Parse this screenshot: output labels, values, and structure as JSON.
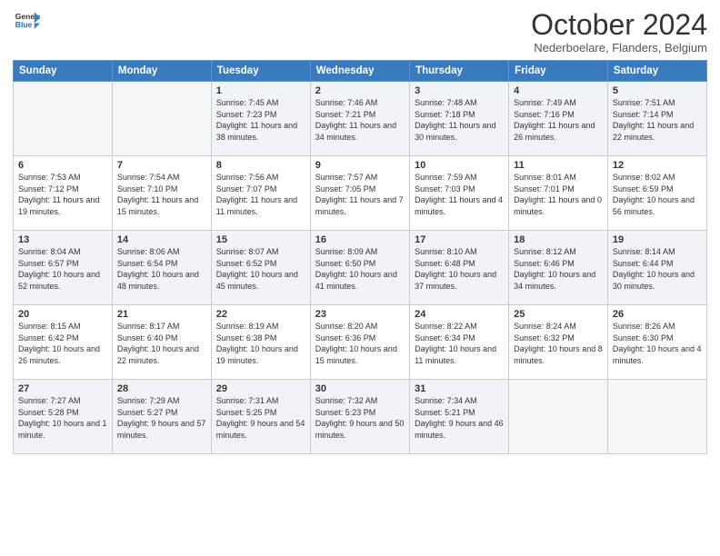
{
  "logo": {
    "general": "General",
    "blue": "Blue"
  },
  "header": {
    "month": "October 2024",
    "location": "Nederboelare, Flanders, Belgium"
  },
  "days_of_week": [
    "Sunday",
    "Monday",
    "Tuesday",
    "Wednesday",
    "Thursday",
    "Friday",
    "Saturday"
  ],
  "weeks": [
    [
      {
        "day": "",
        "sunrise": "",
        "sunset": "",
        "daylight": ""
      },
      {
        "day": "",
        "sunrise": "",
        "sunset": "",
        "daylight": ""
      },
      {
        "day": "1",
        "sunrise": "Sunrise: 7:45 AM",
        "sunset": "Sunset: 7:23 PM",
        "daylight": "Daylight: 11 hours and 38 minutes."
      },
      {
        "day": "2",
        "sunrise": "Sunrise: 7:46 AM",
        "sunset": "Sunset: 7:21 PM",
        "daylight": "Daylight: 11 hours and 34 minutes."
      },
      {
        "day": "3",
        "sunrise": "Sunrise: 7:48 AM",
        "sunset": "Sunset: 7:18 PM",
        "daylight": "Daylight: 11 hours and 30 minutes."
      },
      {
        "day": "4",
        "sunrise": "Sunrise: 7:49 AM",
        "sunset": "Sunset: 7:16 PM",
        "daylight": "Daylight: 11 hours and 26 minutes."
      },
      {
        "day": "5",
        "sunrise": "Sunrise: 7:51 AM",
        "sunset": "Sunset: 7:14 PM",
        "daylight": "Daylight: 11 hours and 22 minutes."
      }
    ],
    [
      {
        "day": "6",
        "sunrise": "Sunrise: 7:53 AM",
        "sunset": "Sunset: 7:12 PM",
        "daylight": "Daylight: 11 hours and 19 minutes."
      },
      {
        "day": "7",
        "sunrise": "Sunrise: 7:54 AM",
        "sunset": "Sunset: 7:10 PM",
        "daylight": "Daylight: 11 hours and 15 minutes."
      },
      {
        "day": "8",
        "sunrise": "Sunrise: 7:56 AM",
        "sunset": "Sunset: 7:07 PM",
        "daylight": "Daylight: 11 hours and 11 minutes."
      },
      {
        "day": "9",
        "sunrise": "Sunrise: 7:57 AM",
        "sunset": "Sunset: 7:05 PM",
        "daylight": "Daylight: 11 hours and 7 minutes."
      },
      {
        "day": "10",
        "sunrise": "Sunrise: 7:59 AM",
        "sunset": "Sunset: 7:03 PM",
        "daylight": "Daylight: 11 hours and 4 minutes."
      },
      {
        "day": "11",
        "sunrise": "Sunrise: 8:01 AM",
        "sunset": "Sunset: 7:01 PM",
        "daylight": "Daylight: 11 hours and 0 minutes."
      },
      {
        "day": "12",
        "sunrise": "Sunrise: 8:02 AM",
        "sunset": "Sunset: 6:59 PM",
        "daylight": "Daylight: 10 hours and 56 minutes."
      }
    ],
    [
      {
        "day": "13",
        "sunrise": "Sunrise: 8:04 AM",
        "sunset": "Sunset: 6:57 PM",
        "daylight": "Daylight: 10 hours and 52 minutes."
      },
      {
        "day": "14",
        "sunrise": "Sunrise: 8:06 AM",
        "sunset": "Sunset: 6:54 PM",
        "daylight": "Daylight: 10 hours and 48 minutes."
      },
      {
        "day": "15",
        "sunrise": "Sunrise: 8:07 AM",
        "sunset": "Sunset: 6:52 PM",
        "daylight": "Daylight: 10 hours and 45 minutes."
      },
      {
        "day": "16",
        "sunrise": "Sunrise: 8:09 AM",
        "sunset": "Sunset: 6:50 PM",
        "daylight": "Daylight: 10 hours and 41 minutes."
      },
      {
        "day": "17",
        "sunrise": "Sunrise: 8:10 AM",
        "sunset": "Sunset: 6:48 PM",
        "daylight": "Daylight: 10 hours and 37 minutes."
      },
      {
        "day": "18",
        "sunrise": "Sunrise: 8:12 AM",
        "sunset": "Sunset: 6:46 PM",
        "daylight": "Daylight: 10 hours and 34 minutes."
      },
      {
        "day": "19",
        "sunrise": "Sunrise: 8:14 AM",
        "sunset": "Sunset: 6:44 PM",
        "daylight": "Daylight: 10 hours and 30 minutes."
      }
    ],
    [
      {
        "day": "20",
        "sunrise": "Sunrise: 8:15 AM",
        "sunset": "Sunset: 6:42 PM",
        "daylight": "Daylight: 10 hours and 26 minutes."
      },
      {
        "day": "21",
        "sunrise": "Sunrise: 8:17 AM",
        "sunset": "Sunset: 6:40 PM",
        "daylight": "Daylight: 10 hours and 22 minutes."
      },
      {
        "day": "22",
        "sunrise": "Sunrise: 8:19 AM",
        "sunset": "Sunset: 6:38 PM",
        "daylight": "Daylight: 10 hours and 19 minutes."
      },
      {
        "day": "23",
        "sunrise": "Sunrise: 8:20 AM",
        "sunset": "Sunset: 6:36 PM",
        "daylight": "Daylight: 10 hours and 15 minutes."
      },
      {
        "day": "24",
        "sunrise": "Sunrise: 8:22 AM",
        "sunset": "Sunset: 6:34 PM",
        "daylight": "Daylight: 10 hours and 11 minutes."
      },
      {
        "day": "25",
        "sunrise": "Sunrise: 8:24 AM",
        "sunset": "Sunset: 6:32 PM",
        "daylight": "Daylight: 10 hours and 8 minutes."
      },
      {
        "day": "26",
        "sunrise": "Sunrise: 8:26 AM",
        "sunset": "Sunset: 6:30 PM",
        "daylight": "Daylight: 10 hours and 4 minutes."
      }
    ],
    [
      {
        "day": "27",
        "sunrise": "Sunrise: 7:27 AM",
        "sunset": "Sunset: 5:28 PM",
        "daylight": "Daylight: 10 hours and 1 minute."
      },
      {
        "day": "28",
        "sunrise": "Sunrise: 7:29 AM",
        "sunset": "Sunset: 5:27 PM",
        "daylight": "Daylight: 9 hours and 57 minutes."
      },
      {
        "day": "29",
        "sunrise": "Sunrise: 7:31 AM",
        "sunset": "Sunset: 5:25 PM",
        "daylight": "Daylight: 9 hours and 54 minutes."
      },
      {
        "day": "30",
        "sunrise": "Sunrise: 7:32 AM",
        "sunset": "Sunset: 5:23 PM",
        "daylight": "Daylight: 9 hours and 50 minutes."
      },
      {
        "day": "31",
        "sunrise": "Sunrise: 7:34 AM",
        "sunset": "Sunset: 5:21 PM",
        "daylight": "Daylight: 9 hours and 46 minutes."
      },
      {
        "day": "",
        "sunrise": "",
        "sunset": "",
        "daylight": ""
      },
      {
        "day": "",
        "sunrise": "",
        "sunset": "",
        "daylight": ""
      }
    ]
  ]
}
